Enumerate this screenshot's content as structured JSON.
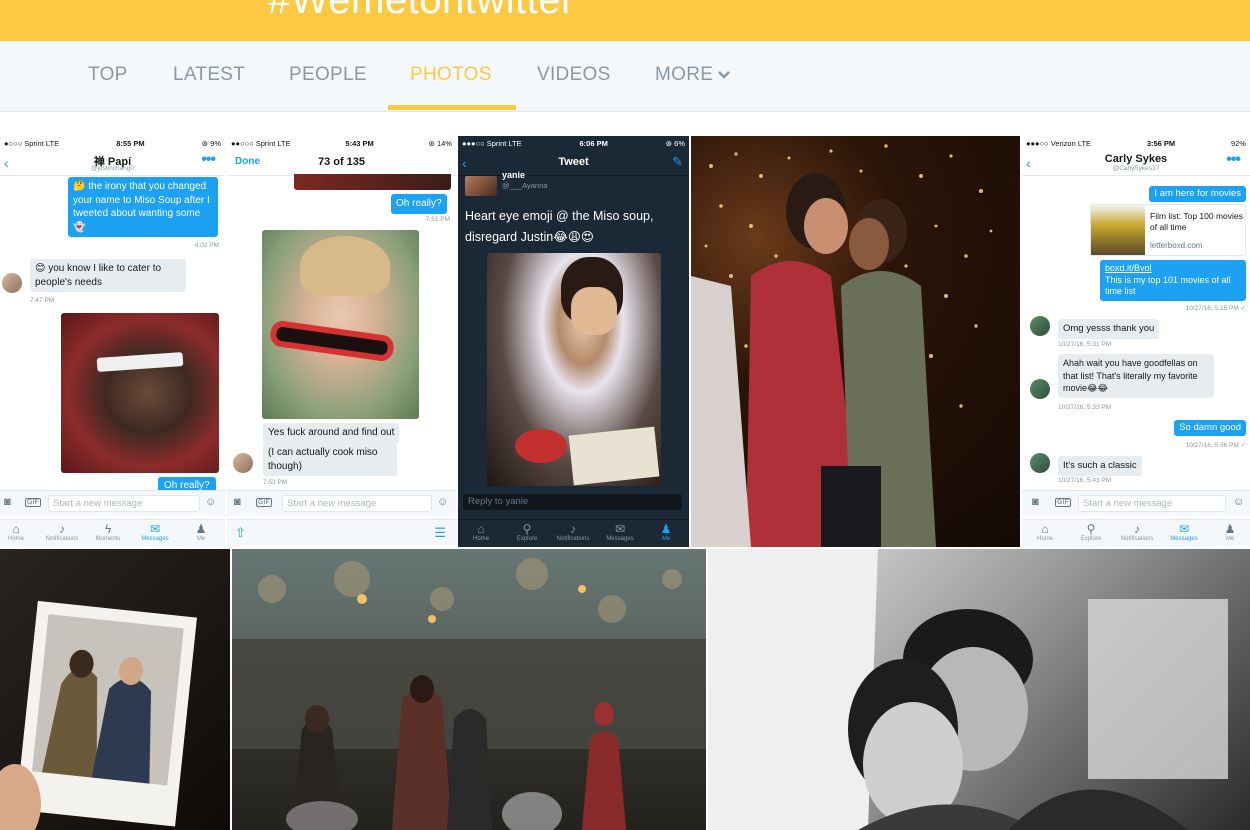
{
  "banner": {
    "hashtag": "#Wemetontwitter"
  },
  "tabs": [
    {
      "label": "TOP",
      "active": false
    },
    {
      "label": "LATEST",
      "active": false
    },
    {
      "label": "PEOPLE",
      "active": false
    },
    {
      "label": "PHOTOS",
      "active": true
    },
    {
      "label": "VIDEOS",
      "active": false
    },
    {
      "label": "MORE",
      "active": false
    }
  ],
  "colors": {
    "accent": "#fdc842",
    "tab_inactive": "#8899a6",
    "twitter_blue": "#1da1f2"
  },
  "tile1": {
    "carrier": "●○○○ Sprint  LTE",
    "time": "8:55 PM",
    "battery": "⊛ 9%",
    "title": "禅 Papí",
    "handle": "@justinchang0",
    "msg1": "🤔 the irony that you changed your name to Miso Soup after I tweeted about wanting some 👻",
    "ts1": "4:02 PM",
    "msg2": "😊 you know I like to cater to people's needs",
    "ts2": "7:47 PM",
    "msg3": "Oh really?",
    "composer_placeholder": "Start a new message",
    "gif": "GIF",
    "tabs": [
      "Home",
      "Notifications",
      "Moments",
      "Messages",
      "Me"
    ]
  },
  "tile2": {
    "carrier": "●●○○○ Sprint  LTE",
    "time": "5:43 PM",
    "battery": "⊛ 14%",
    "done": "Done",
    "counter": "73 of 135",
    "msg1": "Oh really?",
    "ts1": "7:51 PM",
    "msg2": "Yes fuck around and find out",
    "msg3": "(I can actually cook miso though)",
    "ts3": "7:53 PM",
    "composer_placeholder": "Start a new message",
    "gif": "GIF"
  },
  "tile3": {
    "carrier": "●●●○○ Sprint  LTE",
    "time": "6:06 PM",
    "battery": "⊛ 6%",
    "title": "Tweet",
    "name": "yanie",
    "handle": "@___Ayanna",
    "text": "Heart eye emoji @ the Miso soup, disregard Justin😂😩😍",
    "reply_placeholder": "Reply to yanie",
    "tabs": [
      "Home",
      "Explore",
      "Notifications",
      "Messages",
      "Me"
    ]
  },
  "tile5": {
    "carrier": "●●●○○ Verizon  LTE",
    "time": "3:56 PM",
    "battery": "92%",
    "title": "Carly Sykes",
    "handle": "@CarlySykes17",
    "msg1": "I am here for movies",
    "card_title": "Film list: Top 100 movies of all time",
    "card_domain": "letterboxd.com",
    "link": "boxd.it/Bvol",
    "msg2": "This is my top 101 movies of all time list",
    "ts2": "10/27/16, 5:15 PM ✓",
    "msg3": "Omg yesss thank you",
    "ts3": "10/27/16, 5:31 PM",
    "msg4": "Ahah wait you have goodfellas on that list! That's literally my favorite movie😂😂",
    "ts4": "10/27/16, 5:33 PM",
    "msg5": "So damn good",
    "ts5": "10/27/16, 5:36 PM ✓",
    "msg6": "It's such a classic",
    "ts6": "10/27/16, 5:43 PM",
    "composer_placeholder": "Start a new message",
    "gif": "GIF",
    "tabs": [
      "Home",
      "Explore",
      "Notifications",
      "Messages",
      "Me"
    ]
  }
}
